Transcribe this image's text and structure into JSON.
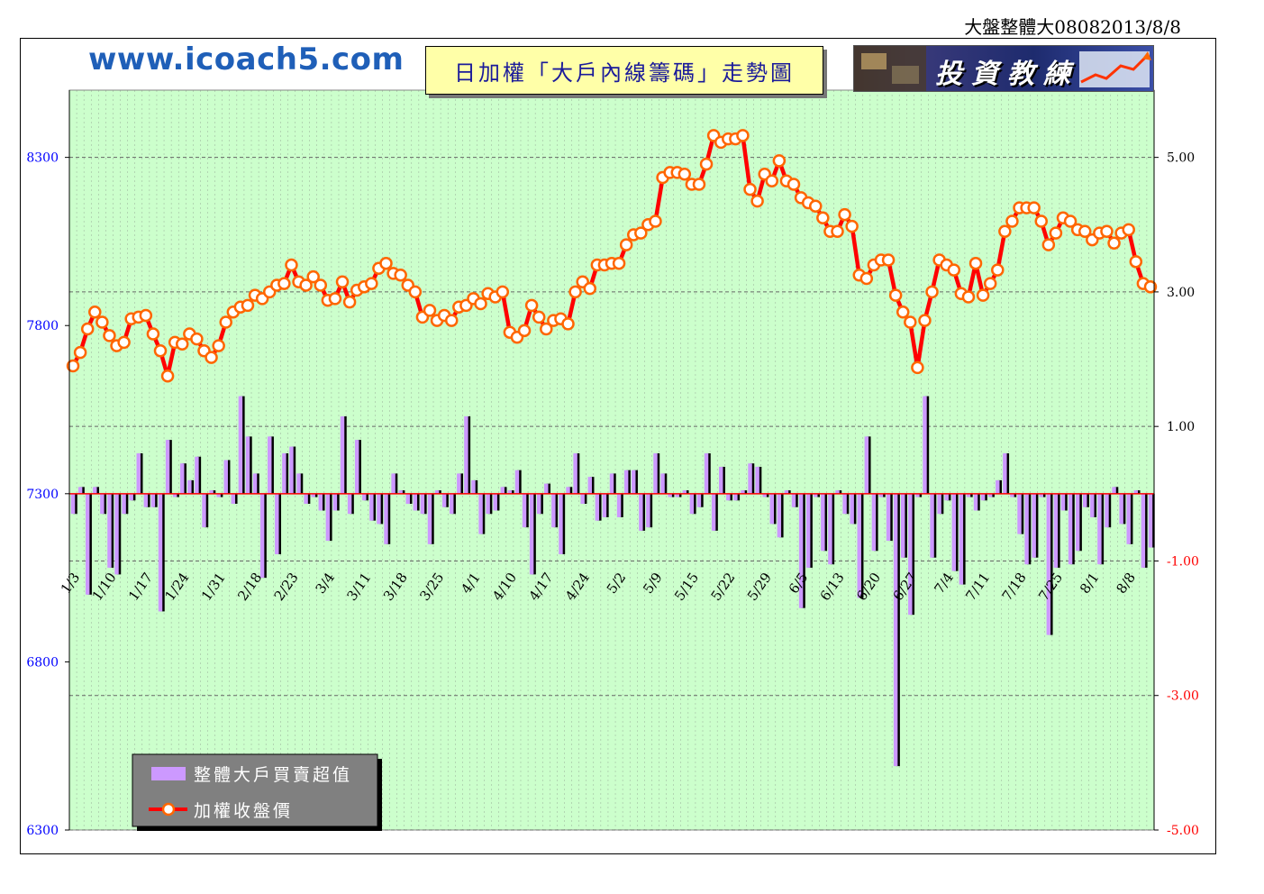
{
  "header": {
    "doc_title": "大盤整體大08082013/8/8",
    "site_url": "www.icoach5.com",
    "chart_title": "日加權「大戶內線籌碼」走勢圖",
    "banner_text": "投資教練"
  },
  "colors": {
    "plot_bg": "#ccffcc",
    "price_line": "#ff0000",
    "marker_fill": "#ffffff",
    "marker_edge": "#ff6600",
    "bar_fill": "#cc99ff",
    "bar_shadow": "#000000",
    "left_axis_text": "#0000ff",
    "right_axis_text": "#000000",
    "negative_axis_text": "#ff0000"
  },
  "chart_data": {
    "type": "line+bar",
    "left_axis": {
      "ylim": [
        6300,
        8500
      ],
      "ticks": [
        6300,
        6800,
        7300,
        7800,
        8300
      ]
    },
    "right_axis": {
      "ylim": [
        -5,
        6
      ],
      "ticks": [
        "5.00",
        "3.00",
        "1.00",
        "-1.00",
        "-3.00",
        "-5.00"
      ],
      "tick_values": [
        5,
        3,
        1,
        -1,
        -3,
        -5
      ]
    },
    "zero_line": 0,
    "grid": true,
    "legend": {
      "placement": "bottom-left",
      "entries": [
        "整體大戶買賣超值",
        "加權收盤價"
      ]
    },
    "x_tick_labels": [
      "1/3",
      "1/10",
      "1/17",
      "1/24",
      "1/31",
      "2/18",
      "2/23",
      "3/4",
      "3/11",
      "3/18",
      "3/25",
      "4/1",
      "4/10",
      "4/17",
      "4/24",
      "5/2",
      "5/9",
      "5/15",
      "5/22",
      "5/29",
      "6/5",
      "6/13",
      "6/20",
      "6/27",
      "7/4",
      "7/11",
      "7/18",
      "7/25",
      "8/1",
      "8/8"
    ],
    "x_tick_indices": [
      0,
      5,
      10,
      15,
      20,
      25,
      30,
      35,
      40,
      45,
      50,
      55,
      60,
      65,
      70,
      75,
      80,
      85,
      90,
      95,
      100,
      105,
      110,
      115,
      120,
      125,
      130,
      135,
      140,
      145
    ],
    "series": [
      {
        "name": "加權收盤價",
        "type": "line",
        "axis": "left",
        "values": [
          7680,
          7720,
          7790,
          7840,
          7810,
          7770,
          7740,
          7750,
          7820,
          7825,
          7830,
          7775,
          7725,
          7650,
          7750,
          7745,
          7775,
          7760,
          7725,
          7705,
          7740,
          7810,
          7840,
          7855,
          7860,
          7890,
          7880,
          7900,
          7920,
          7925,
          7980,
          7930,
          7920,
          7945,
          7920,
          7875,
          7880,
          7930,
          7870,
          7905,
          7915,
          7925,
          7970,
          7985,
          7955,
          7950,
          7920,
          7900,
          7825,
          7845,
          7815,
          7830,
          7815,
          7855,
          7860,
          7880,
          7865,
          7895,
          7885,
          7900,
          7780,
          7765,
          7785,
          7860,
          7825,
          7790,
          7815,
          7820,
          7805,
          7900,
          7930,
          7910,
          7980,
          7980,
          7985,
          7985,
          8040,
          8070,
          8075,
          8100,
          8110,
          8240,
          8255,
          8255,
          8250,
          8220,
          8220,
          8280,
          8365,
          8345,
          8355,
          8355,
          8365,
          8205,
          8170,
          8250,
          8230,
          8290,
          8230,
          8220,
          8180,
          8165,
          8155,
          8120,
          8080,
          8080,
          8130,
          8095,
          7950,
          7940,
          7980,
          7995,
          7995,
          7890,
          7840,
          7810,
          7675,
          7815,
          7900,
          7995,
          7980,
          7965,
          7895,
          7885,
          7985,
          7890,
          7925,
          7965,
          8080,
          8110,
          8150,
          8150,
          8150,
          8110,
          8040,
          8075,
          8120,
          8110,
          8085,
          8080,
          8055,
          8075,
          8080,
          8045,
          8075,
          8085,
          7990,
          7925,
          7915
        ]
      },
      {
        "name": "整體大戶買賣超值",
        "type": "bar",
        "axis": "right",
        "values": [
          -0.3,
          0.1,
          -1.5,
          0.1,
          -0.3,
          -1.1,
          -1.2,
          -0.3,
          -0.1,
          0.6,
          -0.2,
          -0.2,
          -1.75,
          0.8,
          -0.05,
          0.45,
          0.2,
          0.55,
          -0.5,
          0.05,
          -0.05,
          0.5,
          -0.15,
          1.45,
          0.85,
          0.3,
          -1.25,
          0.85,
          -0.9,
          0.6,
          0.7,
          0.3,
          -0.15,
          -0.05,
          -0.25,
          -0.7,
          -0.25,
          1.15,
          -0.3,
          0.8,
          -0.1,
          -0.4,
          -0.45,
          -0.75,
          0.3,
          0.05,
          -0.15,
          -0.25,
          -0.3,
          -0.75,
          0.05,
          -0.2,
          -0.3,
          0.3,
          1.15,
          0.2,
          -0.6,
          -0.3,
          -0.25,
          0.1,
          0.05,
          0.35,
          -0.5,
          -1.2,
          -0.3,
          0.15,
          -0.5,
          -0.9,
          0.1,
          0.6,
          -0.15,
          0.25,
          -0.4,
          -0.35,
          0.3,
          -0.35,
          0.35,
          0.35,
          -0.55,
          -0.5,
          0.6,
          0.3,
          -0.05,
          -0.05,
          0.05,
          -0.3,
          -0.2,
          0.6,
          -0.55,
          0.4,
          -0.1,
          -0.1,
          0.05,
          0.45,
          0.4,
          -0.05,
          -0.45,
          -0.65,
          0.05,
          -0.2,
          -1.7,
          -1.1,
          -0.05,
          -0.85,
          -1.05,
          0.05,
          -0.3,
          -0.45,
          -1.55,
          0.85,
          -0.85,
          -0.05,
          -0.7,
          -4.05,
          -0.95,
          -1.8,
          -0.05,
          1.45,
          -0.95,
          -0.3,
          -0.1,
          -1.15,
          -1.35,
          -0.05,
          -0.25,
          -0.1,
          -0.05,
          0.2,
          0.6,
          -0.05,
          -0.6,
          -1.05,
          -0.95,
          -0.05,
          -2.1,
          -1.1,
          -0.25,
          -1.05,
          -0.85,
          -0.2,
          -0.35,
          -1.05,
          -0.5,
          0.1,
          -0.45,
          -0.75,
          0.05,
          -1.1,
          -0.8
        ]
      }
    ]
  }
}
